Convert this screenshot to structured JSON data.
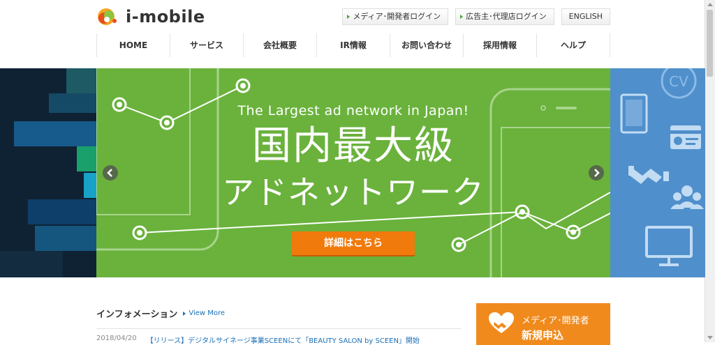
{
  "header": {
    "logo_text": "i-mobile",
    "top_links": [
      {
        "label": "メディア･開発者ログイン"
      },
      {
        "label": "広告主･代理店ログイン"
      },
      {
        "label": "ENGLISH"
      }
    ]
  },
  "nav": {
    "items": [
      {
        "label": "HOME"
      },
      {
        "label": "サービス"
      },
      {
        "label": "会社概要"
      },
      {
        "label": "IR情報"
      },
      {
        "label": "お問い合わせ"
      },
      {
        "label": "採用情報"
      },
      {
        "label": "ヘルプ"
      }
    ]
  },
  "hero": {
    "subtitle": "The Largest ad network in Japan!",
    "title_line1": "国内最大級",
    "title_line2": "アドネットワーク",
    "cta_label": "詳細はこちら",
    "colors": {
      "center": "#6ab23c",
      "right": "#4f8fcc",
      "left": "#0e2030",
      "cta": "#f17a0c"
    },
    "right_icons": [
      "cv-icon",
      "tablet-icon",
      "card-icon",
      "handshake-icon",
      "users-icon",
      "monitor-icon"
    ],
    "arrow_icons": [
      "chevron-left-icon",
      "chevron-right-icon"
    ]
  },
  "info": {
    "title": "インフォメーション",
    "view_more": "View More",
    "news": [
      {
        "date": "2018/04/20",
        "text": "【リリース】デジタルサイネージ事業SCEENにて「BEAUTY SALON by SCEEN」開始"
      }
    ]
  },
  "signup": {
    "line1": "メディア･開発者",
    "line2": "新規申込",
    "icon": "heart-handshake-icon",
    "color": "#f08a1c"
  }
}
